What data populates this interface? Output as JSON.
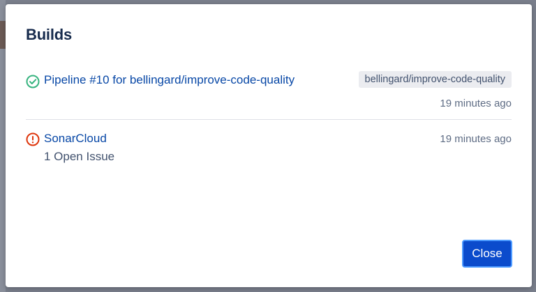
{
  "dialog": {
    "title": "Builds",
    "close_label": "Close"
  },
  "builds": [
    {
      "status": "success",
      "status_icon": "check-circle-icon",
      "status_color": "#36b37e",
      "name": "Pipeline #10 for bellingard/improve-code-quality",
      "branch": "bellingard/improve-code-quality",
      "time": "19 minutes ago"
    },
    {
      "status": "failed",
      "status_icon": "exclamation-circle-icon",
      "status_color": "#de350b",
      "name": "SonarCloud",
      "detail": "1 Open Issue",
      "time": "19 minutes ago"
    }
  ],
  "colors": {
    "link": "#0747a6",
    "primary_button": "#0b4bcc"
  }
}
